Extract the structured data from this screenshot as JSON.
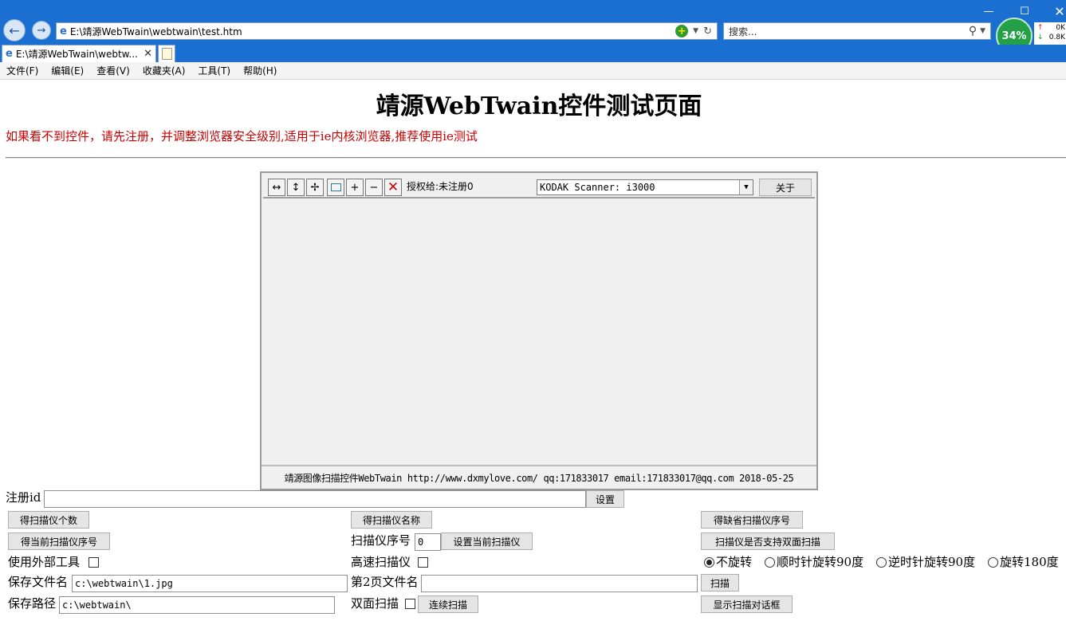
{
  "browser": {
    "address": "E:\\靖源WebTwain\\webtwain\\test.htm",
    "search_placeholder": "搜索...",
    "tab_title": "E:\\靖源WebTwain\\webtw...",
    "network_percent": "34%",
    "speed_up": "0K",
    "speed_down": "0.8K"
  },
  "menu": [
    "文件(F)",
    "编辑(E)",
    "查看(V)",
    "收藏夹(A)",
    "工具(T)",
    "帮助(H)"
  ],
  "page": {
    "title": "靖源WebTwain控件测试页面",
    "warning": "如果看不到控件，请先注册，并调整浏览器安全级别,适用于ie内核浏览器,推荐使用ie测试"
  },
  "control": {
    "license_text": "授权给:未注册0",
    "scanner_selected": "KODAK Scanner: i3000",
    "about_label": "关于",
    "footer_text": "靖源图像扫描控件WebTwain http://www.dxmylove.com/ qq:171833017 email:171833017@qq.com 2018-05-25"
  },
  "form": {
    "reg_label": "注册id",
    "reg_value": "",
    "set_button": "设置",
    "btn_get_count": "得扫描仪个数",
    "btn_get_names": "得扫描仪名称",
    "btn_get_default": "得缺省扫描仪序号",
    "btn_get_current": "得当前扫描仪序号",
    "scanner_index_label": "扫描仪序号",
    "scanner_index_value": "0",
    "btn_set_current": "设置当前扫描仪",
    "btn_duplex_support": "扫描仪是否支持双面扫描",
    "external_tool_label": "使用外部工具",
    "high_speed_label": "高速扫描仪",
    "rotate_options": [
      "不旋转",
      "顺时针旋转90度",
      "逆时针旋转90度",
      "旋转180度"
    ],
    "save_filename_label": "保存文件名",
    "save_filename_value": "c:\\webtwain\\1.jpg",
    "page2_filename_label": "第2页文件名",
    "page2_filename_value": "",
    "scan_button": "扫描",
    "save_path_label": "保存路径",
    "save_path_value": "c:\\webtwain\\",
    "duplex_label": "双面扫描",
    "continuous_scan_button": "连续扫描",
    "show_dialog_button": "显示扫描对话框"
  }
}
